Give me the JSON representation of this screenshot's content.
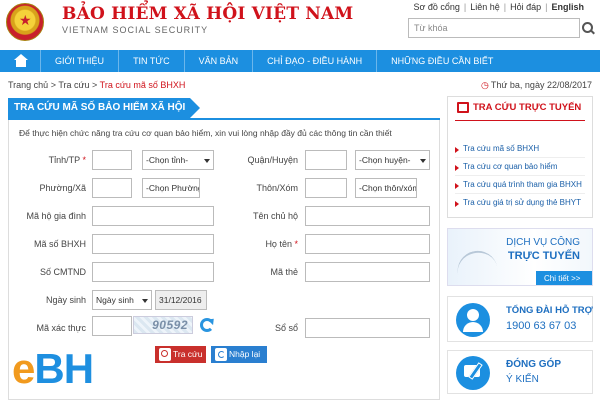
{
  "header": {
    "brand_title": "BẢO HIỂM XÃ HỘI VIỆT NAM",
    "brand_subtitle": "VIETNAM SOCIAL SECURITY",
    "top_links": [
      "Sơ đồ cổng",
      "Liên hệ",
      "Hỏi đáp",
      "English"
    ],
    "search_placeholder": "Từ khóa"
  },
  "nav": {
    "items": [
      "GIỚI THIỆU",
      "TIN TỨC",
      "VĂN BẢN",
      "CHỈ ĐẠO - ĐIỀU HÀNH",
      "NHỮNG ĐIỀU CẦN BIẾT"
    ]
  },
  "breadcrumb": {
    "items": [
      "Trang chủ",
      "Tra cứu",
      "Tra cứu mã số BHXH"
    ],
    "separator": ">"
  },
  "date_text": "Thứ ba, ngày 22/08/2017",
  "form": {
    "title": "TRA CỨU MÃ SỐ BẢO HIỂM XÃ HỘI",
    "intro": "Để thực hiện chức năng tra cứu cơ quan bảo hiểm, xin vui lòng nhập đầy đủ các thông tin cần thiết",
    "labels": {
      "province": "Tỉnh/TP",
      "district": "Quận/Huyện",
      "ward": "Phường/Xã",
      "village": "Thôn/Xóm",
      "household_code": "Mã hộ gia đình",
      "household_head": "Tên chủ hộ",
      "bhxh_code": "Mã số BHXH",
      "full_name": "Họ tên",
      "cmtnd": "Số CMTND",
      "card_code": "Mã thẻ",
      "dob": "Ngày sinh",
      "captcha": "Mã xác thực",
      "book_no": "Sổ sổ"
    },
    "required_mark": "*",
    "selects": {
      "province": "-Chọn tỉnh-",
      "district": "-Chọn huyện-",
      "ward": "-Chọn Phường/xã-",
      "village": "-Chọn thôn/xóm-",
      "dob_type": "Ngày sinh"
    },
    "dob_value": "31/12/2016",
    "captcha_text": "90592",
    "buttons": {
      "search": "Tra cứu",
      "reset": "Nhập lại"
    }
  },
  "sidebar": {
    "title": "TRA CỨU TRỰC TUYẾN",
    "items": [
      "Tra cứu mã số BHXH",
      "Tra cứu cơ quan bảo hiểm",
      "Tra cứu quá trình tham gia BHXH",
      "Tra cứu giá trị sử dụng thẻ BHYT"
    ]
  },
  "banners": {
    "service_line1": "DỊCH VỤ CÔNG",
    "service_line2": "TRỰC TUYẾN",
    "service_more": "Chi tiết >>",
    "hotline_title": "TỔNG ĐÀI HỖ TRỢ",
    "hotline_number": "1900 63 67 03",
    "feedback_title": "ĐÓNG GÓP",
    "feedback_sub": "Ý KIẾN"
  },
  "watermark": {
    "e": "e",
    "bh": "BH"
  },
  "colors": {
    "brand_red": "#d0121b",
    "nav_blue": "#1c8fe0",
    "watermark_orange": "#f19a1e"
  }
}
